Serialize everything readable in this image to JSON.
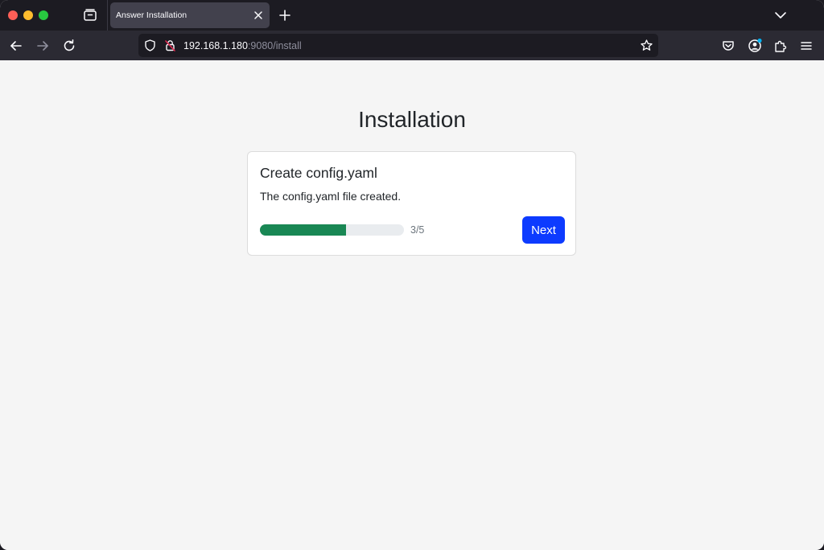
{
  "browser": {
    "tab": {
      "title": "Answer Installation"
    },
    "url": {
      "host": "192.168.1.180",
      "rest": ":9080/install"
    }
  },
  "page": {
    "title": "Installation",
    "card": {
      "title": "Create config.yaml",
      "text": "The config.yaml file created.",
      "progress": {
        "current": 3,
        "total": 5,
        "label": "3/5",
        "color": "#198754"
      },
      "next_label": "Next"
    }
  },
  "icons": {
    "tabs": "tabs-icon",
    "close": "close-icon",
    "new_tab": "plus-icon",
    "tab_list": "chevron-down-icon",
    "back": "arrow-left-icon",
    "forward": "arrow-right-icon",
    "reload": "reload-icon",
    "shield": "shield-icon",
    "lock": "lock-insecure-icon",
    "bookmark": "star-icon",
    "pocket": "pocket-icon",
    "account": "account-icon",
    "extensions": "puzzle-icon",
    "menu": "hamburger-menu-icon"
  },
  "colors": {
    "accent": "#0d3bff",
    "progress": "#198754",
    "chrome_dark": "#1c1b22",
    "page_bg": "#f5f5f5"
  }
}
